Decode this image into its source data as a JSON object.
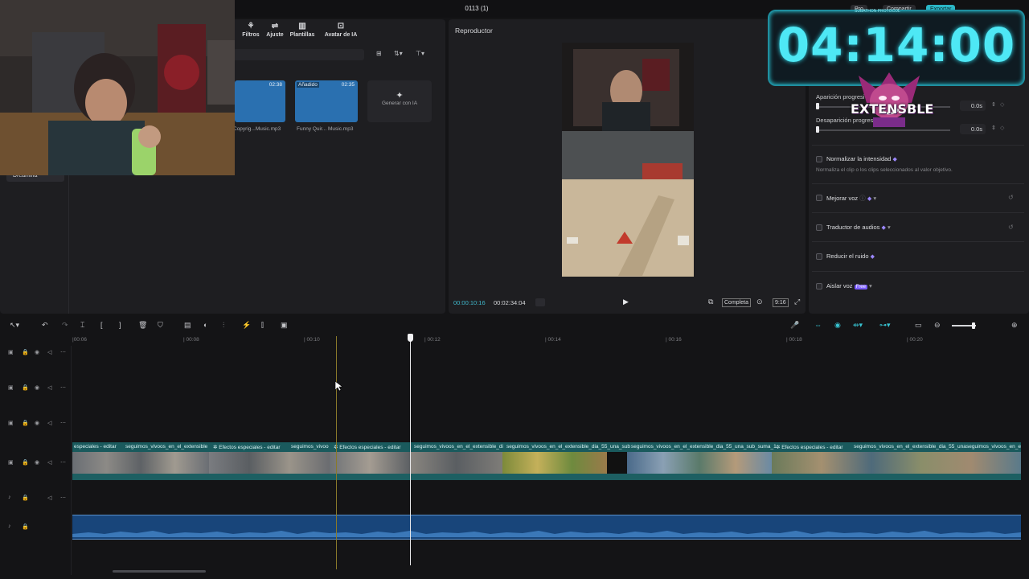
{
  "window": {
    "title": "0113 (1)",
    "pro_label": "Pro",
    "share_label": "Compartir",
    "export_label": "Exportar"
  },
  "media": {
    "tabs": [
      {
        "label": "Filtros",
        "icon": "filters-icon"
      },
      {
        "label": "Ajuste",
        "icon": "adjust-icon"
      },
      {
        "label": "Plantillas",
        "icon": "templates-icon"
      },
      {
        "label": "Avatar de IA",
        "icon": "ai-avatar-icon"
      }
    ],
    "sidebar_item": "Dreamina",
    "cards": [
      {
        "duration": "02:38",
        "caption": "Copyrig...Music.mp3"
      },
      {
        "duration": "02:35",
        "badge": "Añadido",
        "caption": "Funny Quir... Music.mp3"
      }
    ],
    "generate_label": "Generar con IA"
  },
  "player": {
    "title": "Reproductor",
    "time_current": "00:00:10:16",
    "time_total": "00:02:34:04",
    "completa_label": "Completa",
    "ratio_label": "9:16"
  },
  "right_panel": {
    "fade_in_label": "Aparición progresiva",
    "fade_in_value": "0.0s",
    "fade_out_label": "Desaparición progresiva",
    "fade_out_value": "0.0s",
    "normalize_label": "Normalizar la intensidad",
    "normalize_desc": "Normaliza el clip o los clips seleccionados al valor objetivo.",
    "enhance_voice_label": "Mejorar voz",
    "translator_label": "Traductor de audios",
    "reduce_noise_label": "Reducir el ruido",
    "isolate_voice_label": "Aislar voz",
    "free_tag": "Free"
  },
  "overlay": {
    "timer": "04:14:00",
    "timer_caption": "SUBATHON PROTOCOL",
    "logo_text": "EXTENSBLE"
  },
  "timeline": {
    "ruler_labels": [
      "|00:06",
      "| 00:08",
      "| 00:10",
      "| 00:12",
      "| 00:14",
      "| 00:16",
      "| 00:18",
      "| 00:20"
    ],
    "clip_labels": [
      "especiales - editar",
      "seguimos_vivoos_en_el_extensible",
      "Efectos especiales - editar",
      "seguimos_vivoo",
      "Efectos especiales - editar",
      "seguimos_vivoos_en_el_extensible_di",
      "seguimos_vivoos_en_el_extensible_dia_55_una_sub",
      "seguimos_vivoos_en_el_extensible_dia_55_una_sub_suma_1",
      "Efectos especiales - editar",
      "seguimos_vivoos_en_el_extensible_dia_55_una",
      "seguimos_vivoos_en_e"
    ]
  },
  "colors": {
    "accent_teal": "#38c4d2",
    "timer_cyan": "#4ee8f5",
    "audio_blue": "#18457a",
    "video_teal": "#1a5a5d"
  }
}
